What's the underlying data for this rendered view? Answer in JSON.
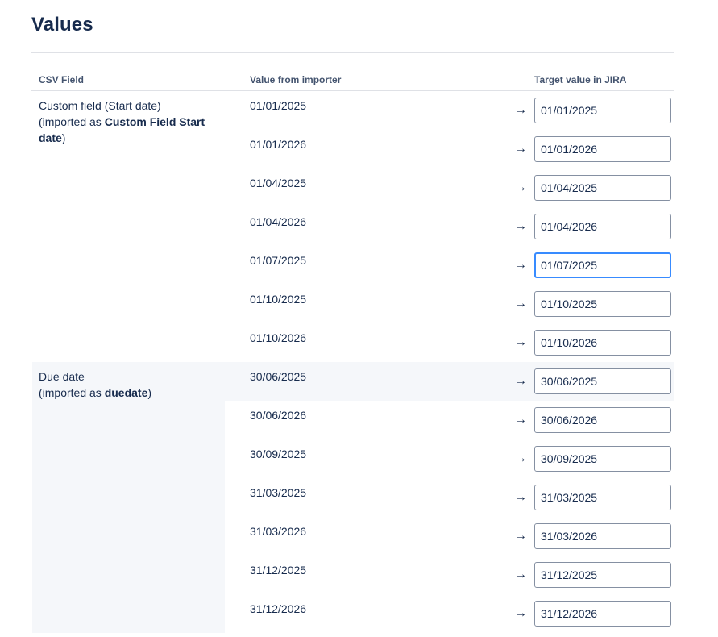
{
  "page": {
    "title": "Values"
  },
  "columns": {
    "csv_field": "CSV Field",
    "value_from_importer": "Value from importer",
    "target_value": "Target value in JIRA"
  },
  "fields": [
    {
      "name": "Custom field (Start date)",
      "imported_prefix": "(imported as ",
      "imported_as": "Custom Field Start date",
      "imported_suffix": ")"
    },
    {
      "name": "Due date",
      "imported_prefix": "(imported as ",
      "imported_as": "duedate",
      "imported_suffix": ")"
    }
  ],
  "arrow_glyph": "→",
  "rows": [
    {
      "source": "01/01/2025",
      "target": "01/01/2025"
    },
    {
      "source": "01/01/2026",
      "target": "01/01/2026"
    },
    {
      "source": "01/04/2025",
      "target": "01/04/2025"
    },
    {
      "source": "01/04/2026",
      "target": "01/04/2026"
    },
    {
      "source": "01/07/2025",
      "target": "01/07/2025",
      "focused": true
    },
    {
      "source": "01/10/2025",
      "target": "01/10/2025"
    },
    {
      "source": "01/10/2026",
      "target": "01/10/2026"
    },
    {
      "source": "30/06/2025",
      "target": "30/06/2025"
    },
    {
      "source": "30/06/2026",
      "target": "30/06/2026"
    },
    {
      "source": "30/09/2025",
      "target": "30/09/2025"
    },
    {
      "source": "31/03/2025",
      "target": "31/03/2025"
    },
    {
      "source": "31/03/2026",
      "target": "31/03/2026"
    },
    {
      "source": "31/12/2025",
      "target": "31/12/2025"
    },
    {
      "source": "31/12/2026",
      "target": "31/12/2026"
    }
  ]
}
